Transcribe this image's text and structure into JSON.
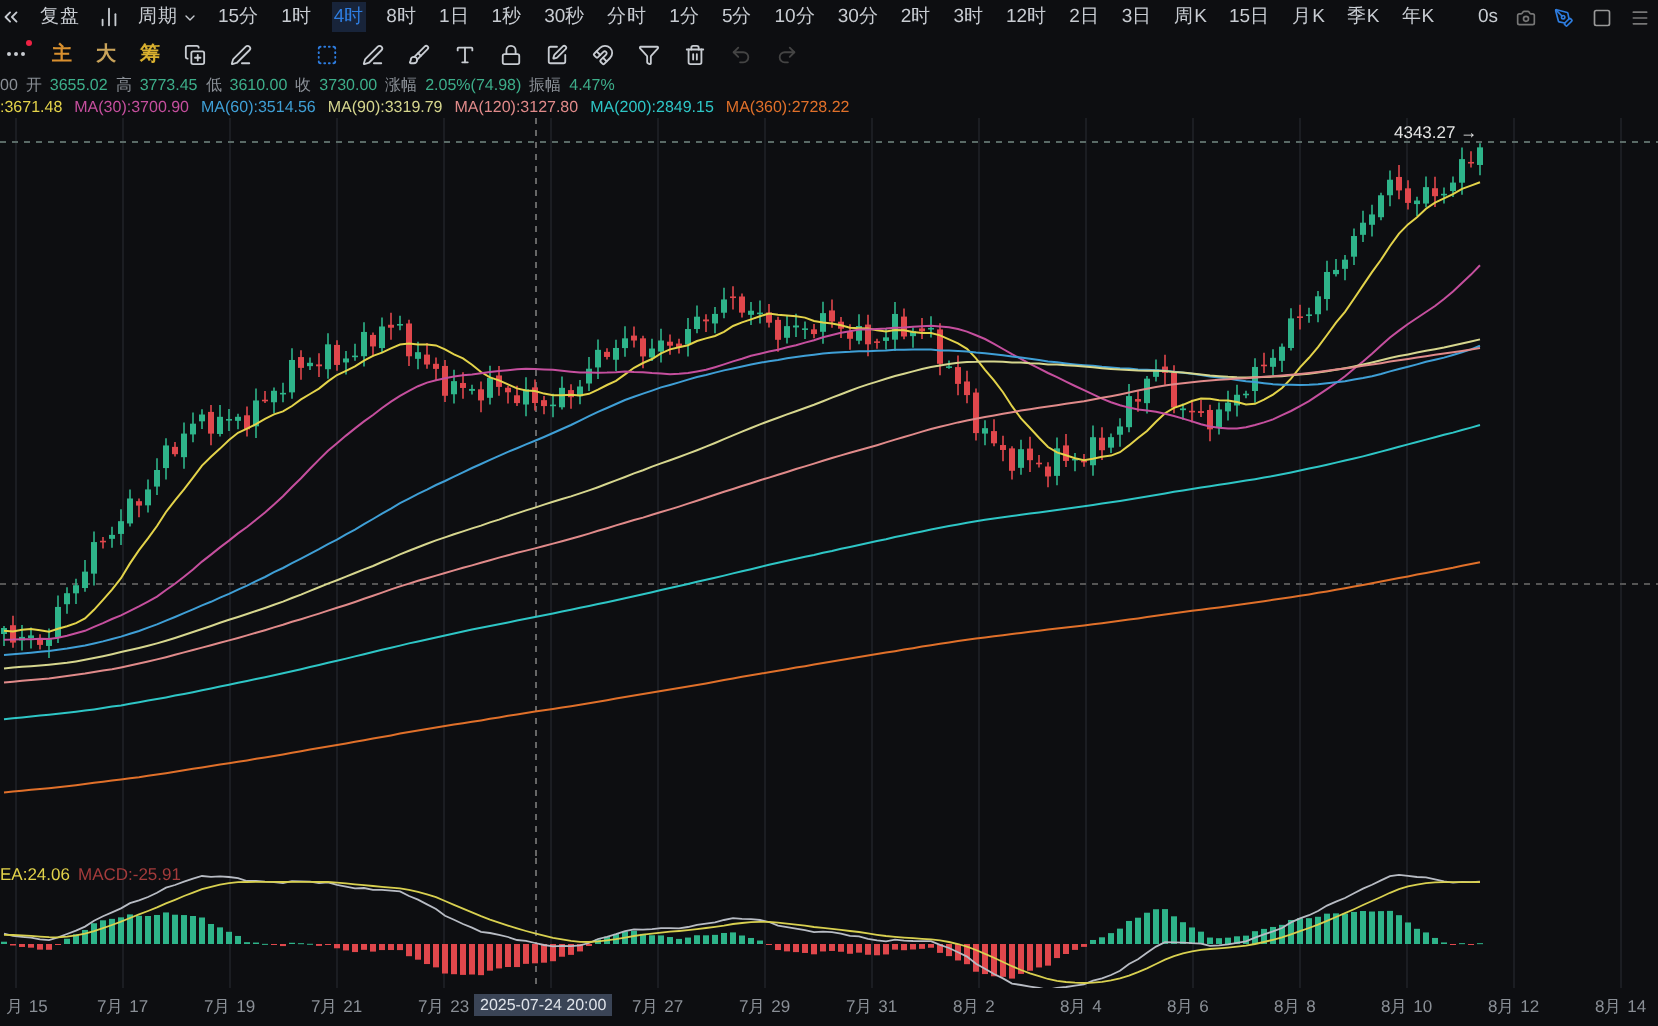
{
  "toolbar": {
    "replay": "复盘",
    "period_menu": "周期",
    "periods": [
      {
        "label": "15分",
        "selected": false
      },
      {
        "label": "1时",
        "selected": false
      },
      {
        "label": "4时",
        "selected": true
      },
      {
        "label": "8时",
        "selected": false
      },
      {
        "label": "1日",
        "selected": false
      },
      {
        "label": "1秒",
        "selected": false
      },
      {
        "label": "30秒",
        "selected": false
      },
      {
        "label": "分时",
        "selected": false
      },
      {
        "label": "1分",
        "selected": false
      },
      {
        "label": "5分",
        "selected": false
      },
      {
        "label": "10分",
        "selected": false
      },
      {
        "label": "30分",
        "selected": false
      },
      {
        "label": "2时",
        "selected": false
      },
      {
        "label": "3时",
        "selected": false
      },
      {
        "label": "12时",
        "selected": false
      },
      {
        "label": "2日",
        "selected": false
      },
      {
        "label": "3日",
        "selected": false
      },
      {
        "label": "周K",
        "selected": false
      },
      {
        "label": "15日",
        "selected": false
      },
      {
        "label": "月K",
        "selected": false
      },
      {
        "label": "季K",
        "selected": false
      },
      {
        "label": "年K",
        "selected": false
      }
    ],
    "timer": "0s"
  },
  "indicator_toggles": [
    {
      "label": "主",
      "color": "#d9902f"
    },
    {
      "label": "大",
      "color": "#c9a35a"
    },
    {
      "label": "筹",
      "color": "#d9b02f"
    }
  ],
  "ohlc": {
    "lead": "00",
    "items": [
      {
        "label": "开",
        "value": "3655.02"
      },
      {
        "label": "高",
        "value": "3773.45"
      },
      {
        "label": "低",
        "value": "3610.00"
      },
      {
        "label": "收",
        "value": "3730.00"
      },
      {
        "label": "涨幅",
        "value": "2.05%(74.98)"
      },
      {
        "label": "振幅",
        "value": "4.47%"
      }
    ]
  },
  "moving_averages": [
    {
      "text": ":3671.48",
      "color": "#e3d34a"
    },
    {
      "text": "MA(30):3700.90",
      "color": "#c54f9e"
    },
    {
      "text": "MA(60):3514.56",
      "color": "#3f9fd6"
    },
    {
      "text": "MA(90):3319.79",
      "color": "#d6d68e"
    },
    {
      "text": "MA(120):3127.80",
      "color": "#e08a8a"
    },
    {
      "text": "MA(200):2849.15",
      "color": "#2ec6c6"
    },
    {
      "text": "MA(360):2728.22",
      "color": "#e0702a"
    }
  ],
  "price_tag": "4343.27 →",
  "macd": [
    {
      "text": "EA:24.06",
      "color": "#e3d34a"
    },
    {
      "text": "MACD:-25.91",
      "color": "#a33b3b"
    }
  ],
  "x_axis": [
    {
      "kind": "date",
      "label": "月 15"
    },
    {
      "kind": "date",
      "label": "7月 17"
    },
    {
      "kind": "date",
      "label": "7月 19"
    },
    {
      "kind": "date",
      "label": "7月 21"
    },
    {
      "kind": "date",
      "label": "7月 23"
    },
    {
      "kind": "crosshair",
      "label": "2025-07-24 20:00"
    },
    {
      "kind": "date",
      "label": "7月 27"
    },
    {
      "kind": "date",
      "label": "7月 29"
    },
    {
      "kind": "date",
      "label": "7月 31"
    },
    {
      "kind": "date",
      "label": "8月 2"
    },
    {
      "kind": "date",
      "label": "8月 4"
    },
    {
      "kind": "date",
      "label": "8月 6"
    },
    {
      "kind": "date",
      "label": "8月 8"
    },
    {
      "kind": "date",
      "label": "8月 10"
    },
    {
      "kind": "date",
      "label": "8月 12"
    },
    {
      "kind": "date",
      "label": "8月 14"
    }
  ]
}
